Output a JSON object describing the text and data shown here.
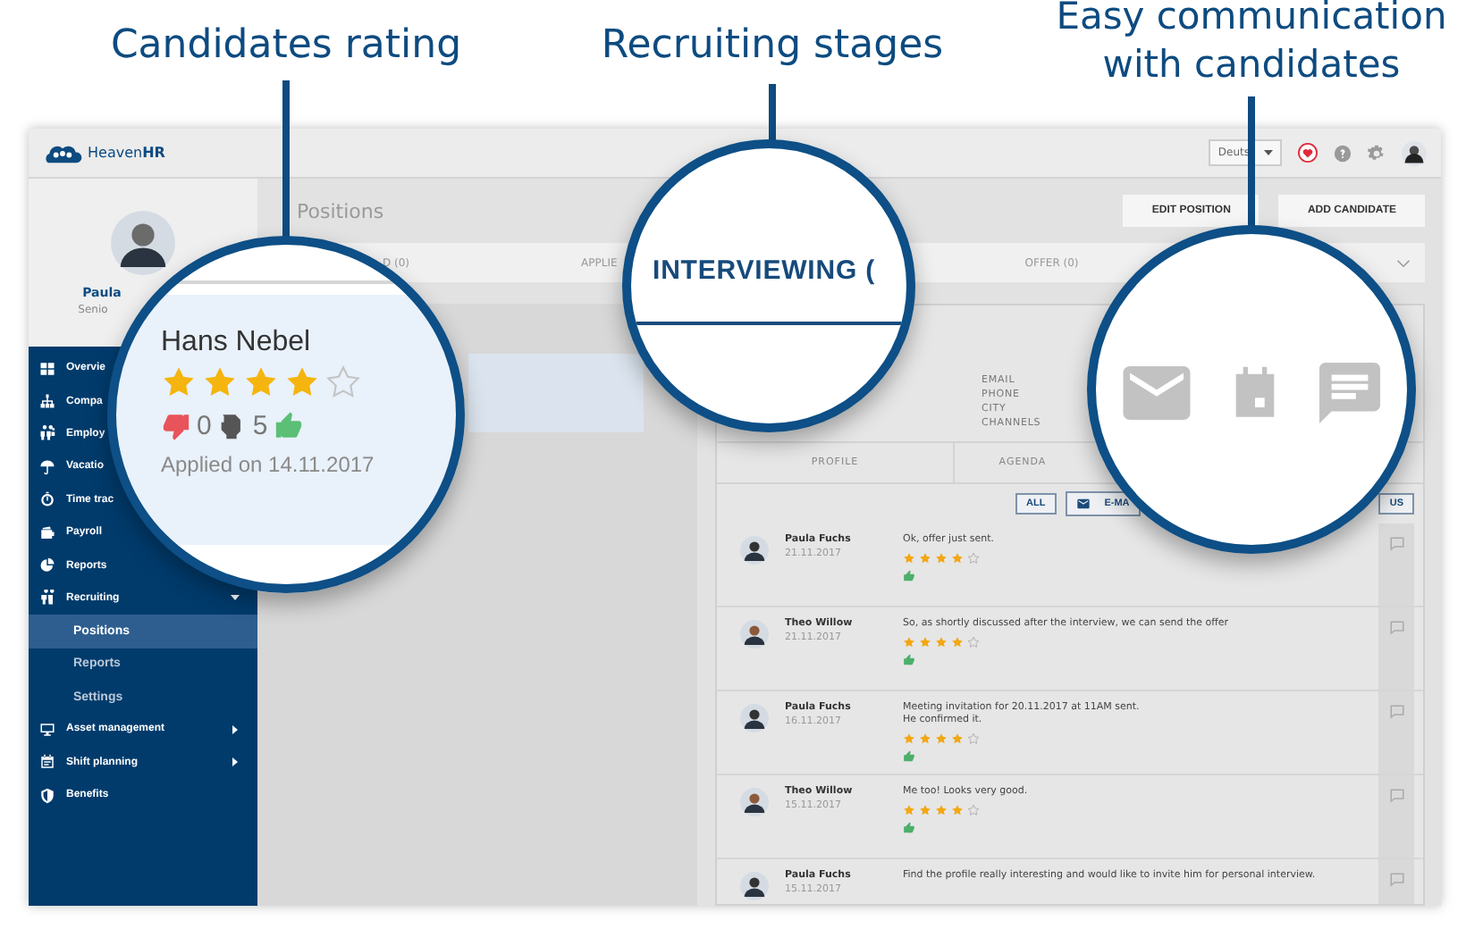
{
  "callouts": [
    {
      "title": "Candidates rating"
    },
    {
      "title": "Recruiting stages"
    },
    {
      "title": "Easy communication with candidates"
    }
  ],
  "topbar": {
    "logo": "Heaven**HR**",
    "language": "Deuts"
  },
  "profile": {
    "name": "Paula",
    "role": "Senio"
  },
  "nav": [
    {
      "label": "Overvie"
    },
    {
      "label": "Compa"
    },
    {
      "label": "Employ"
    },
    {
      "label": "Vacatio"
    },
    {
      "label": "Time trac"
    },
    {
      "label": "Payroll"
    },
    {
      "label": "Reports"
    },
    {
      "label": "Recruiting",
      "expanded": true,
      "children": [
        {
          "label": "Positions",
          "selected": true
        },
        {
          "label": "Reports",
          "selected": false
        },
        {
          "label": "Settings",
          "selected": false
        }
      ]
    },
    {
      "label": "Asset management",
      "expanded": false
    },
    {
      "label": "Shift planning",
      "expanded": false
    },
    {
      "label": "Benefits"
    }
  ],
  "page": {
    "title": "Positions",
    "buttons": [
      "EDIT POSITION",
      "ADD CANDIDATE"
    ]
  },
  "stages": [
    {
      "label": "D (0)",
      "selected": false
    },
    {
      "label": "APPLIE",
      "selected": false
    },
    {
      "label": "OFFER (0)",
      "selected": false
    }
  ],
  "candidate_card": {
    "name": "Hans Nebel",
    "stars": 4,
    "dislikes": "0",
    "neutral": "5",
    "applied": "Applied on 14.11.2017"
  },
  "stage_zoom": {
    "label": "INTERVIEWING (",
    "selected": true
  },
  "contact_fields": [
    "EMAIL",
    "PHONE",
    "CITY",
    "CHANNELS"
  ],
  "detail_tabs": [
    {
      "label": "PROFILE",
      "selected": false
    },
    {
      "label": "AGENDA",
      "selected": false
    }
  ],
  "filters": [
    "ALL",
    "E-MA",
    "US"
  ],
  "feed": [
    {
      "author": "Paula Fuchs",
      "date": "21.11.2017",
      "message": "Ok, offer just sent.",
      "stars": 4
    },
    {
      "author": "Theo Willow",
      "date": "21.11.2017",
      "message": "So, as shortly discussed after the interview, we can send the offer",
      "stars": 4
    },
    {
      "author": "Paula Fuchs",
      "date": "16.11.2017",
      "message": "Meeting invitation for 20.11.2017 at 11AM sent.\nHe confirmed it.",
      "stars": 4
    },
    {
      "author": "Theo Willow",
      "date": "15.11.2017",
      "message": "Me too! Looks very good.",
      "stars": 4
    },
    {
      "author": "Paula Fuchs",
      "date": "15.11.2017",
      "message": "Find the profile really interesting and would like to invite him for personal interview."
    }
  ]
}
